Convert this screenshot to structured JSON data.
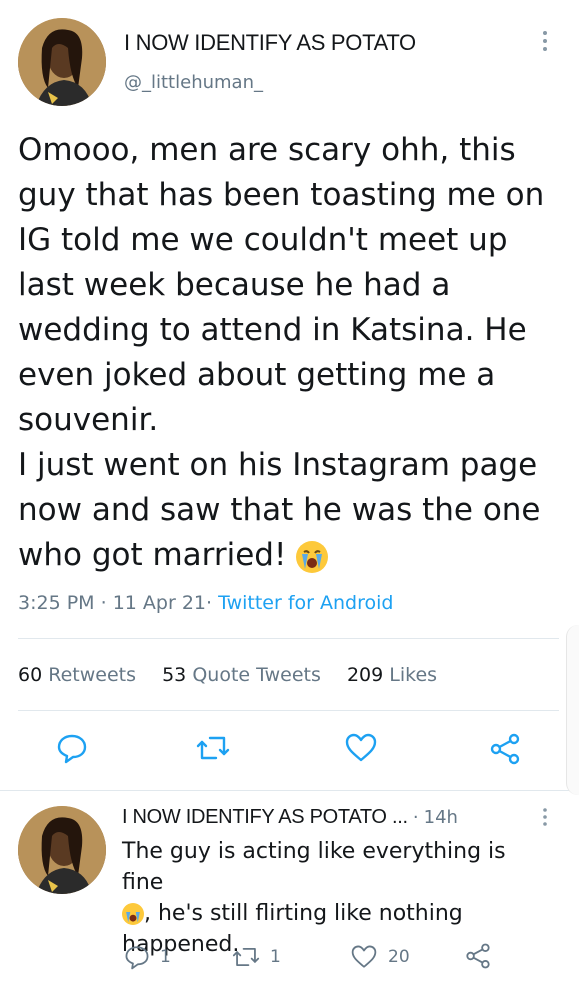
{
  "main_tweet": {
    "display_name": "I NOW IDENTIFY AS POTATO",
    "handle": "@_littlehuman_",
    "text_before_emoji": "Omooo, men are scary ohh, this guy that has been toasting me on IG told me we couldn't meet up last week because he had a wedding to attend in Katsina. He even joked about getting me a souvenir.\nI just went on his Instagram page now and saw that he was the one who got married! ",
    "emoji": "loudly-crying-face-emoji",
    "time": "3:25 PM",
    "date": "11 Apr 21",
    "source": "Twitter for Android",
    "retweets_count": "60",
    "retweets_label": "Retweets",
    "quotes_count": "53",
    "quotes_label": "Quote Tweets",
    "likes_count": "209",
    "likes_label": "Likes"
  },
  "reply_tweet": {
    "display_name": "I NOW IDENTIFY AS POTATO ...",
    "age": "14h",
    "text_before_emoji": "The guy is acting like everything is fine",
    "text_after_emoji": ", he's still flirting like nothing happened.",
    "reply_count": "1",
    "retweet_count": "1",
    "like_count": "20"
  },
  "separators": {
    "dot": "·"
  },
  "colors": {
    "accent": "#1da1f2",
    "muted": "#657786",
    "divider": "#e1e8ed"
  }
}
